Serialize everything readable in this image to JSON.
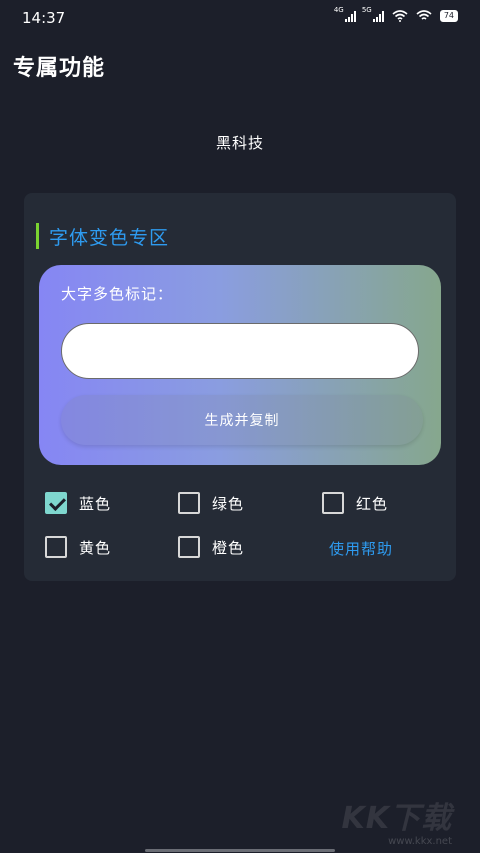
{
  "status_bar": {
    "time": "14:37",
    "signal_1_label": "4G",
    "signal_2_label": "5G",
    "battery": "74"
  },
  "header": {
    "title": "专属功能"
  },
  "subtitle": "黑科技",
  "card": {
    "section_title": "字体变色专区",
    "panel": {
      "label": "大字多色标记：",
      "input_value": "",
      "input_placeholder": "",
      "button_label": "生成并复制"
    },
    "options": [
      {
        "label": "蓝色",
        "checked": true
      },
      {
        "label": "绿色",
        "checked": false
      },
      {
        "label": "红色",
        "checked": false
      },
      {
        "label": "黄色",
        "checked": false
      },
      {
        "label": "橙色",
        "checked": false
      }
    ],
    "help_link": "使用帮助"
  },
  "watermark": {
    "text": "KK下载",
    "url": "www.kkx.net"
  },
  "colors": {
    "background": "#1c1f2a",
    "card": "#252b36",
    "accent_blue": "#2e9bf0",
    "accent_green": "#7bd331",
    "checked": "#7fd7cf"
  },
  "icons": [
    "signal-4g-icon",
    "signal-5g-icon",
    "wifi-icon",
    "hotspot-icon",
    "battery-icon",
    "checkmark-icon"
  ]
}
